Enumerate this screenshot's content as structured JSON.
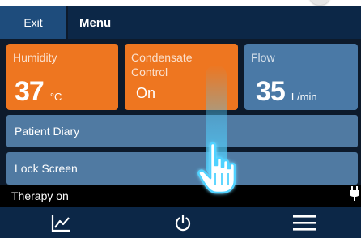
{
  "header": {
    "exit_label": "Exit",
    "title": "Menu"
  },
  "tiles": [
    {
      "label": "Humidity",
      "value": "37",
      "unit": "°C",
      "color": "#ee7620"
    },
    {
      "label": "Condensate Control",
      "label_line1": "Condensate",
      "label_line2": "Control",
      "value": "On",
      "color": "#ee7620"
    },
    {
      "label": "Flow",
      "value": "35",
      "unit": "L/min",
      "color": "#4a79a6"
    }
  ],
  "menu_items": [
    {
      "label": "Patient Diary"
    },
    {
      "label": "Lock Screen"
    }
  ],
  "status": {
    "text": "Therapy on",
    "plug_icon": "plug-icon"
  },
  "nav": {
    "items": [
      {
        "icon": "chart-icon"
      },
      {
        "icon": "power-icon"
      },
      {
        "icon": "hamburger-menu-icon"
      }
    ]
  },
  "colors": {
    "orange": "#ee7620",
    "tile_blue": "#4a79a6",
    "row_blue": "#507aa2",
    "header_dark": "#0c2747",
    "exit_blue": "#1e4c7c",
    "touch_cyan": "#55c8f5"
  }
}
